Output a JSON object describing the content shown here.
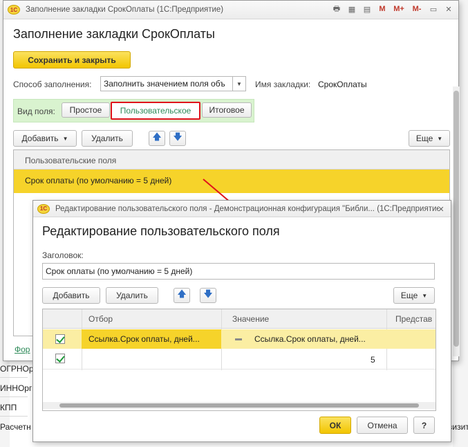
{
  "background": {
    "rows": [
      "ОГРНОр",
      "ИННОрг",
      "КПП",
      "Расчетн"
    ],
    "right_text": "визит",
    "link": "Фор"
  },
  "main_window": {
    "title": "Заполнение закладки СрокОплаты (1С:Предприятие)",
    "heading": "Заполнение закладки СрокОплаты",
    "save_close": "Сохранить и закрыть",
    "fill_method_label": "Способ заполнения:",
    "fill_method_value": "Заполнить значением поля объ",
    "bookmark_name_label": "Имя закладки:",
    "bookmark_name_value": "СрокОплаты",
    "field_type_label": "Вид поля:",
    "field_types": [
      "Простое",
      "Пользовательское",
      "Итоговое"
    ],
    "add": "Добавить",
    "delete": "Удалить",
    "more": "Еще",
    "grid_header": "Пользовательские поля",
    "grid_row": "Срок оплаты (по умолчанию = 5 дней)",
    "toolbar_icons": [
      "print-icon",
      "calculator-icon",
      "calendar-icon",
      "M",
      "M+",
      "M-",
      "window-icon",
      "close-icon"
    ]
  },
  "dialog": {
    "title": "Редактирование пользовательского поля - Демонстрационная конфигурация \"Библи...  (1С:Предприятие)",
    "heading": "Редактирование пользовательского поля",
    "caption_label": "Заголовок:",
    "caption_value": "Срок оплаты (по умолчанию = 5 дней)",
    "add": "Добавить",
    "delete": "Удалить",
    "more": "Еще",
    "columns": [
      "Отбор",
      "Значение",
      "Представ"
    ],
    "rows": [
      {
        "checked": true,
        "filter": "Ссылка.Срок оплаты, дней...",
        "value": "Ссылка.Срок оплаты, дней..."
      },
      {
        "checked": true,
        "filter": "",
        "value": "5"
      }
    ],
    "ok": "ОК",
    "cancel": "Отмена",
    "help": "?"
  }
}
